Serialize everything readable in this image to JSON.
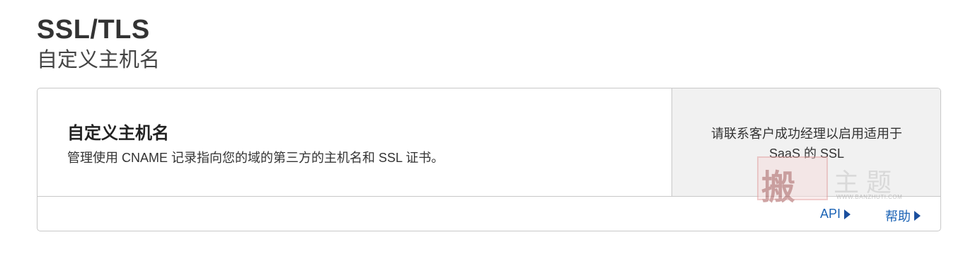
{
  "header": {
    "title": "SSL/TLS",
    "subtitle": "自定义主机名"
  },
  "card": {
    "heading": "自定义主机名",
    "description": "管理使用 CNAME 记录指向您的域的第三方的主机名和 SSL 证书。",
    "side_note_line1": "请联系客户成功经理以启用适用于",
    "side_note_line2": "SaaS 的 SSL",
    "footer_links": {
      "api_label": "API",
      "help_label": "帮助"
    }
  },
  "watermark": {
    "seal_char": "搬",
    "brand": "主题",
    "url": "WWW.BANZHUTI.COM"
  },
  "colors": {
    "link": "#1b63b5",
    "side_panel_bg": "#f1f1f1",
    "border": "#c8c8c8"
  }
}
